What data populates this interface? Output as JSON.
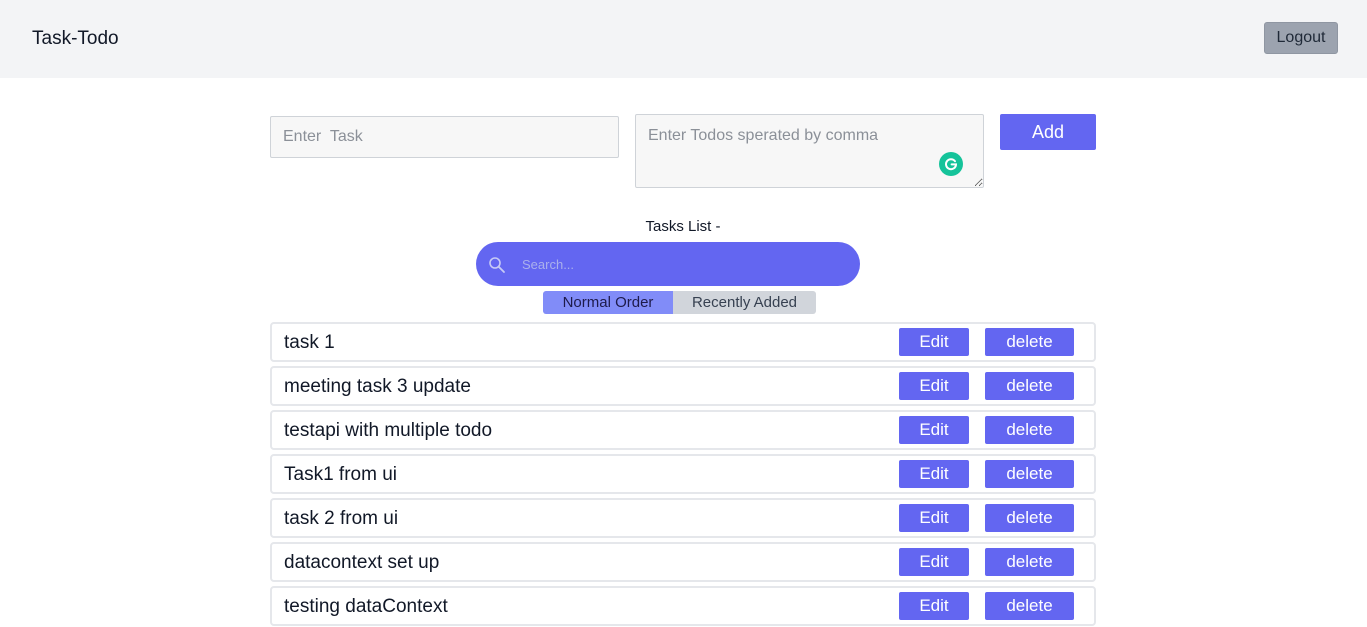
{
  "header": {
    "brand": "Task-Todo",
    "logout_label": "Logout"
  },
  "form": {
    "task_placeholder": "Enter  Task",
    "task_value": "",
    "todos_placeholder": "Enter Todos sperated by comma",
    "todos_value": "",
    "add_label": "Add",
    "grammar_icon": "grammarly-icon"
  },
  "list": {
    "title": "Tasks List -",
    "search_placeholder": "Search...",
    "search_icon": "search-icon",
    "order_options": [
      "Normal Order",
      "Recently Added"
    ],
    "selected_order": "Normal Order",
    "edit_label": "Edit",
    "delete_label": "delete",
    "tasks": [
      {
        "name": "task 1"
      },
      {
        "name": "meeting task 3 update"
      },
      {
        "name": "testapi with multiple todo"
      },
      {
        "name": "Task1 from ui"
      },
      {
        "name": "task 2 from ui"
      },
      {
        "name": "datacontext set up"
      },
      {
        "name": "testing dataContext"
      }
    ]
  },
  "colors": {
    "accent": "#6366f1",
    "active_toggle": "#818cf8",
    "header_bg": "#f3f4f6",
    "logout_bg": "#9ca3af",
    "grammarly": "#15c39a"
  }
}
